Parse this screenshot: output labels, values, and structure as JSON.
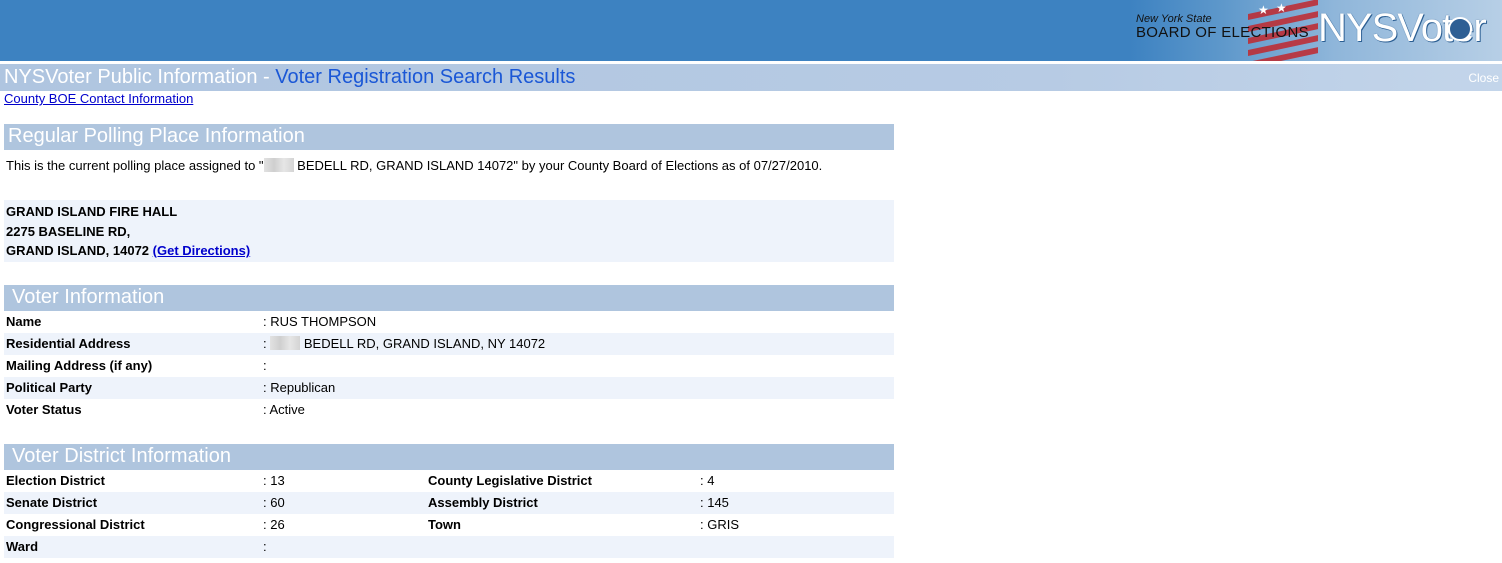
{
  "header": {
    "board_state": "New York State",
    "board_name": "BOARD OF ELECTIONS",
    "product": "NYSVoter"
  },
  "title": {
    "main": "NYSVoter Public Information",
    "separator": " - ",
    "sub": "Voter Registration Search Results",
    "close_label": "Close"
  },
  "contact_link": "County BOE Contact Information",
  "polling": {
    "heading": "Regular Polling Place Information",
    "intro_before": "This is the current polling place assigned to \"",
    "intro_after": " BEDELL RD, GRAND ISLAND 14072\" by your County Board of Elections as of 07/27/2010.",
    "place_name": "GRAND ISLAND FIRE HALL",
    "street": "2275 BASELINE RD,",
    "city": "GRAND ISLAND, 14072 ",
    "directions_label": "(Get Directions)"
  },
  "voter": {
    "heading": "Voter Information",
    "rows": [
      {
        "label": "Name",
        "value": ": RUS THOMPSON"
      },
      {
        "label": "Residential Address",
        "value": " BEDELL RD, GRAND ISLAND, NY 14072"
      },
      {
        "label": "Mailing Address (if any)",
        "value": ":"
      },
      {
        "label": "Political Party",
        "value": ": Republican"
      },
      {
        "label": "Voter Status",
        "value": ": Active"
      }
    ]
  },
  "district": {
    "heading": "Voter District Information",
    "rows": [
      {
        "label1": "Election District",
        "value1": ": 13",
        "label2": "County Legislative District",
        "value2": ": 4"
      },
      {
        "label1": "Senate District",
        "value1": ": 60",
        "label2": "Assembly District",
        "value2": ": 145"
      },
      {
        "label1": "Congressional District",
        "value1": ": 26",
        "label2": "Town",
        "value2": ": GRIS"
      },
      {
        "label1": "Ward",
        "value1": ":",
        "label2": "",
        "value2": ""
      }
    ]
  },
  "colors": {
    "banner": "#3d82c1",
    "section_header": "#afc5de",
    "alt_row": "#eef3fb",
    "link": "#0000cc",
    "title_sub": "#1a57d6"
  }
}
